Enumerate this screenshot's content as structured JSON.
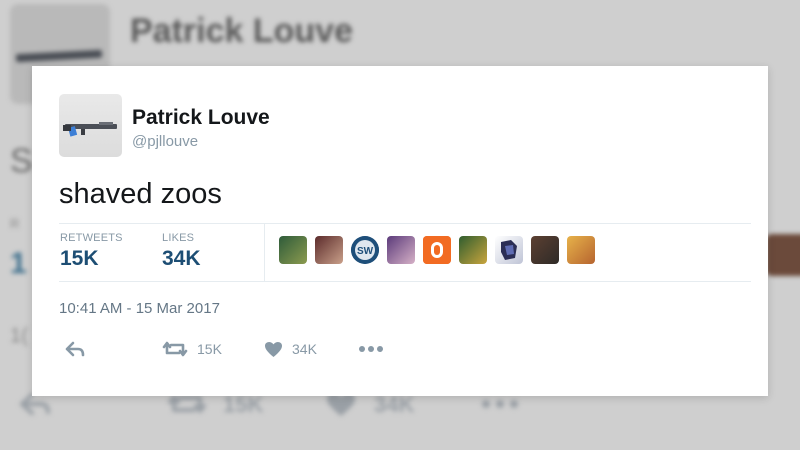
{
  "tweet": {
    "author_name": "Patrick Louve",
    "handle": "@pjllouve",
    "text": "shaved zoos",
    "stats": {
      "retweets_label": "RETWEETS",
      "retweets_value": "15K",
      "likes_label": "LIKES",
      "likes_value": "34K"
    },
    "liker_avatars": [
      "liker-avatar-1",
      "liker-avatar-2",
      "liker-avatar-3",
      "liker-avatar-4",
      "liker-avatar-5",
      "liker-avatar-6",
      "liker-avatar-7",
      "liker-avatar-8",
      "liker-avatar-9"
    ],
    "timestamp": "10:41 AM - 15 Mar 2017",
    "actions": {
      "reply_icon": "reply-icon",
      "retweet_icon": "retweet-icon",
      "retweet_count": "15K",
      "like_icon": "heart-icon",
      "like_count": "34K",
      "more_icon": "more-dots-icon"
    }
  },
  "background": {
    "author_name": "Patrick Louve",
    "text_fragment": "S",
    "retweets_fragment": "1",
    "label_fragment": "R",
    "time_fragment": "1(",
    "retweet_count": "15K",
    "like_count": "34K"
  },
  "colors": {
    "accent": "#1d4e74",
    "muted": "#8899a6",
    "text": "#14171a"
  }
}
